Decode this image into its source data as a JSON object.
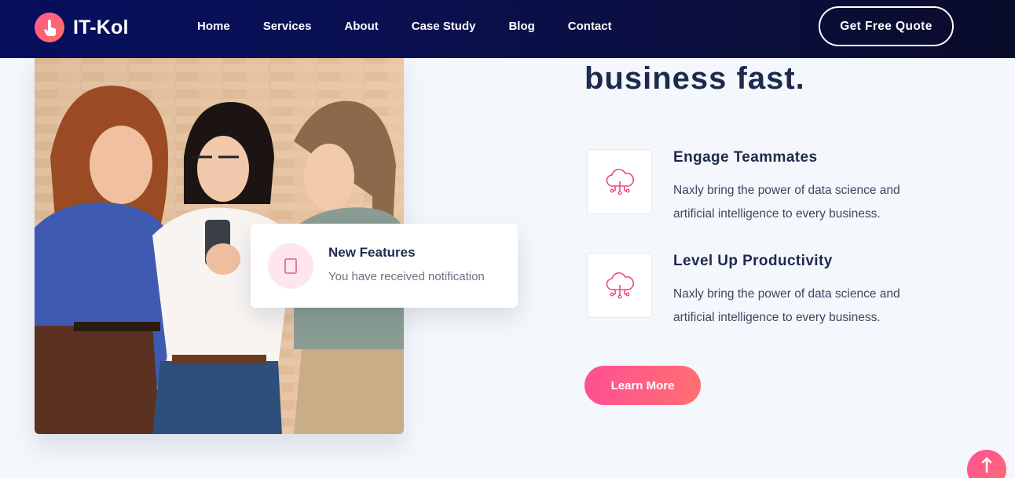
{
  "brand": {
    "name": "IT-Kol",
    "accent": "#ff5a8c",
    "icon": "touch-hand-icon"
  },
  "nav": {
    "links": [
      "Home",
      "Services",
      "About",
      "Case Study",
      "Blog",
      "Contact"
    ],
    "cta": "Get Free Quote"
  },
  "notification": {
    "title": "New Features",
    "text": "You have received notification",
    "icon": "notification-icon"
  },
  "hero": {
    "headline": "business fast."
  },
  "features": [
    {
      "title": "Engage Teammates",
      "text": "Naxly bring the power of data science and artificial intelligence to every business.",
      "icon": "cloud-network-icon"
    },
    {
      "title": "Level Up Productivity",
      "text": "Naxly bring the power of data science and artificial intelligence to every business.",
      "icon": "cloud-network-icon"
    }
  ],
  "learn_more": "Learn More",
  "colors": {
    "navy": "#0a1050",
    "heading": "#1d2a4d",
    "pink": "#ff4f94",
    "coral": "#ff6f71"
  }
}
